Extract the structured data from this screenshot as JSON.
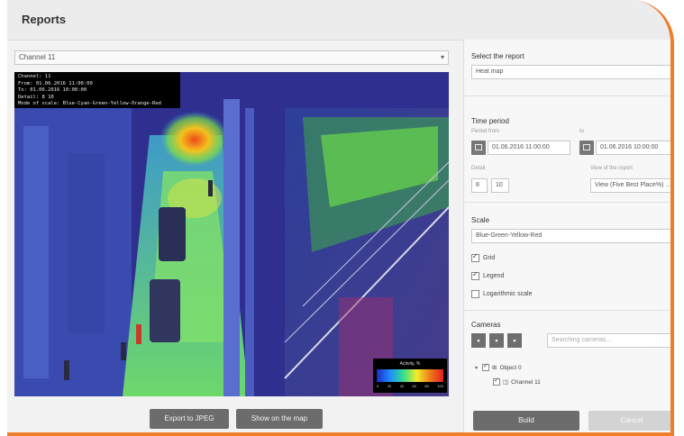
{
  "window": {
    "title": "Reports"
  },
  "channel_select": {
    "value": "Channel 11"
  },
  "video": {
    "osd_lines": [
      "Channel: 11",
      "From: 01.06.2016 11:00:00",
      "To: 01.06.2016 10:00:00",
      "Detail: 8  10",
      "Mode of scale: Blue-Cyan-Green-Yellow-Orange-Red"
    ],
    "legend": {
      "title": "Activity, %",
      "ticks": [
        "0",
        "20",
        "40",
        "60",
        "80",
        "100"
      ],
      "colors": [
        "#1b2cc9",
        "#1f8cff",
        "#33e08c",
        "#f1ee2a",
        "#f07a1a",
        "#e11f1f"
      ]
    }
  },
  "left_buttons": {
    "export": "Export to JPEG",
    "show_on_map": "Show on the map"
  },
  "report": {
    "label": "Select the report",
    "value": "Heat map"
  },
  "time_period": {
    "label": "Time period",
    "from_label": "Period from",
    "from_value": "01.06.2016 11:00:00",
    "to_label": "to",
    "to_value": "01.06.2016 10:00:00",
    "detail_label": "Detail",
    "detail_a": "8",
    "detail_b": "10",
    "view_mode_label": "View of the report",
    "view_mode_value": "View (Five Best Place%) ..."
  },
  "scale": {
    "label": "Scale",
    "value": "Blue-Green-Yellow-Red"
  },
  "options": {
    "grid": "Grid",
    "legend": "Legend",
    "logarithmic": "Logarithmic scale"
  },
  "cameras": {
    "label": "Cameras",
    "search_placeholder": "Searching cameras...",
    "tree": [
      {
        "label": "Object 0"
      },
      {
        "label": "Channel 11"
      }
    ]
  },
  "right_buttons": {
    "build": "Build",
    "cancel": "Cancel"
  }
}
